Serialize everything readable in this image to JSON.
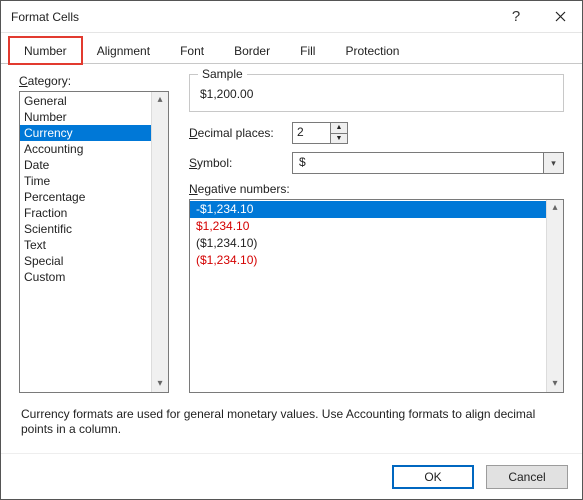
{
  "window": {
    "title": "Format Cells"
  },
  "tabs": {
    "number": "Number",
    "alignment": "Alignment",
    "font": "Font",
    "border": "Border",
    "fill": "Fill",
    "protection": "Protection"
  },
  "category": {
    "label": "Category:",
    "items": {
      "general": "General",
      "number": "Number",
      "currency": "Currency",
      "accounting": "Accounting",
      "date": "Date",
      "time": "Time",
      "percentage": "Percentage",
      "fraction": "Fraction",
      "scientific": "Scientific",
      "text": "Text",
      "special": "Special",
      "custom": "Custom"
    }
  },
  "sample": {
    "label": "Sample",
    "value": "$1,200.00"
  },
  "decimal": {
    "label": "Decimal places:",
    "value": "2"
  },
  "symbol": {
    "label": "Symbol:",
    "value": "$"
  },
  "negative": {
    "label": "Negative numbers:",
    "items": {
      "a": "-$1,234.10",
      "b": "$1,234.10",
      "c": "($1,234.10)",
      "d": "($1,234.10)"
    }
  },
  "description": "Currency formats are used for general monetary values.  Use Accounting formats to align decimal points in a column.",
  "buttons": {
    "ok": "OK",
    "cancel": "Cancel"
  }
}
